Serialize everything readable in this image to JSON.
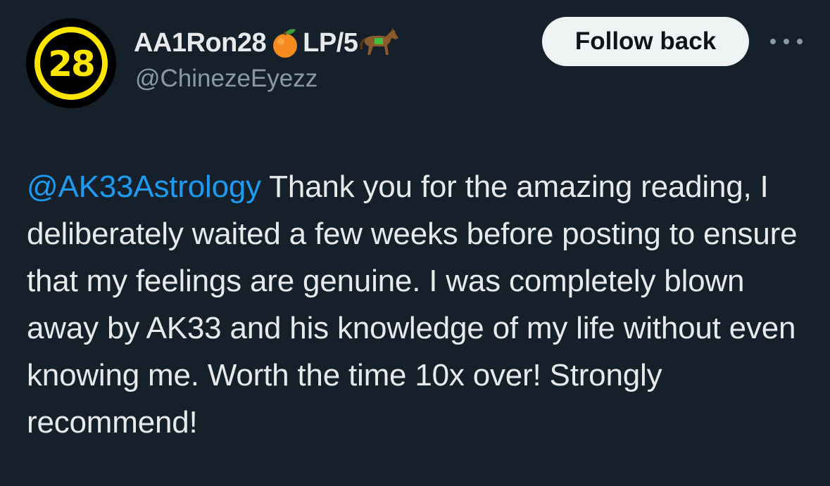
{
  "colors": {
    "background": "#15202b",
    "text_primary": "#e7e9ea",
    "text_secondary": "#8b98a5",
    "link": "#1d9bf0",
    "avatar_accent": "#ffe600",
    "button_bg": "#eff3f4"
  },
  "author": {
    "avatar_text": "28",
    "name_prefix": "AA1Ron28",
    "name_emoji_1": "orange-emoji",
    "name_middle": "LP/5",
    "name_emoji_2": "horse-emoji",
    "handle": "@ChinezeEyezz"
  },
  "actions": {
    "follow_label": "Follow back",
    "more_icon": "more-horizontal-icon"
  },
  "tweet": {
    "mention": "@AK33Astrology",
    "text": " Thank you for the amazing reading, I deliberately waited a few weeks before posting to ensure that my feelings are genuine. I was completely blown away by AK33 and his knowledge of my life without even knowing me. Worth the time 10x over! Strongly recommend!"
  }
}
